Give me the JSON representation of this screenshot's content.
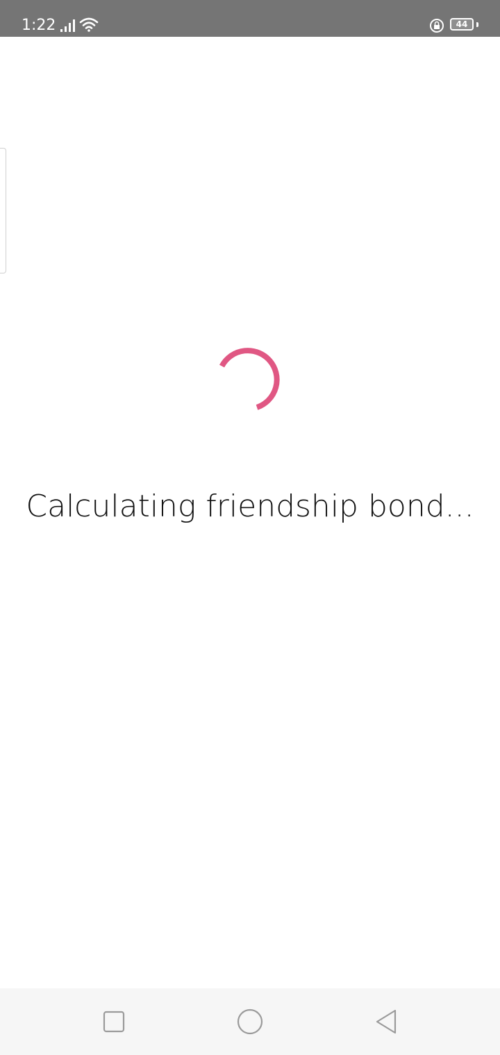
{
  "status_bar": {
    "time": "1:22",
    "battery_level": "44",
    "icons": [
      "signal-icon",
      "wifi-icon",
      "rotation-lock-icon",
      "battery-icon"
    ]
  },
  "loading": {
    "message": "Calculating friendship bond...",
    "spinner_color": "#E05783"
  },
  "nav_bar": {
    "buttons": [
      "recent-apps-icon",
      "home-icon",
      "back-icon"
    ]
  },
  "colors": {
    "status_bar_bg": "#757575",
    "page_bg": "#FFFFFF",
    "nav_bar_bg": "#F6F6F6",
    "accent": "#E05783"
  }
}
